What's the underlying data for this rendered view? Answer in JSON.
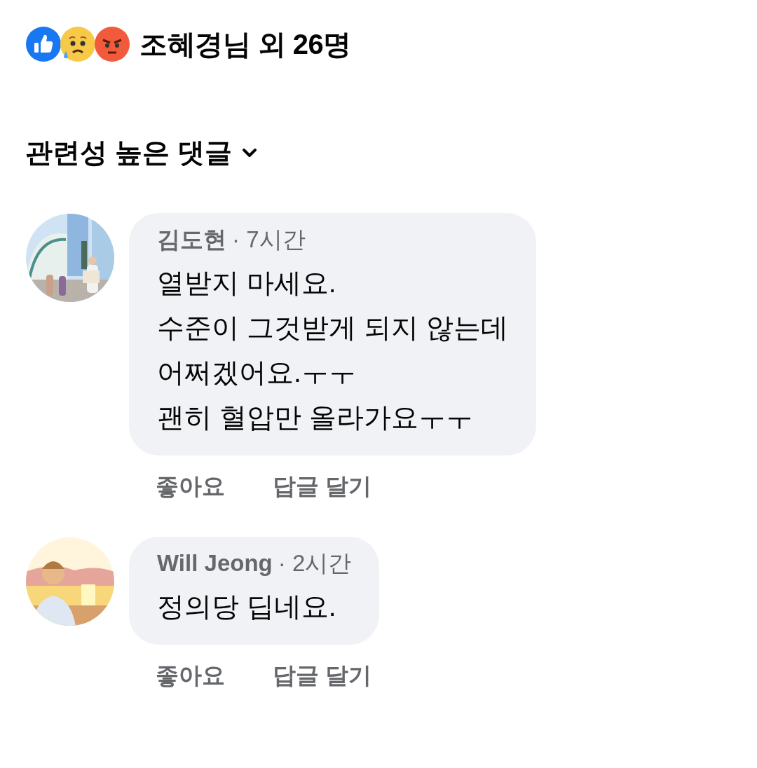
{
  "reactions": {
    "icons": [
      {
        "kind": "like"
      },
      {
        "kind": "sad"
      },
      {
        "kind": "angry"
      }
    ],
    "summary": "조혜경님 외 26명"
  },
  "sort": {
    "label": "관련성 높은 댓글"
  },
  "comments": [
    {
      "author": "김도현",
      "time": "· 7시간",
      "text": "열받지 마세요.\n수준이 그것받게 되지 않는데\n어쩌겠어요.ㅜㅜ\n괜히 혈압만 올라가요ㅜㅜ",
      "avatar": {
        "kind": "picture"
      },
      "actions": [
        "좋아요",
        "답글 달기"
      ]
    },
    {
      "author": "Will Jeong",
      "time": "· 2시간",
      "text": "정의당 딥네요.",
      "avatar": {
        "kind": "picture"
      },
      "actions": [
        "좋아요",
        "답글 달기"
      ]
    }
  ]
}
